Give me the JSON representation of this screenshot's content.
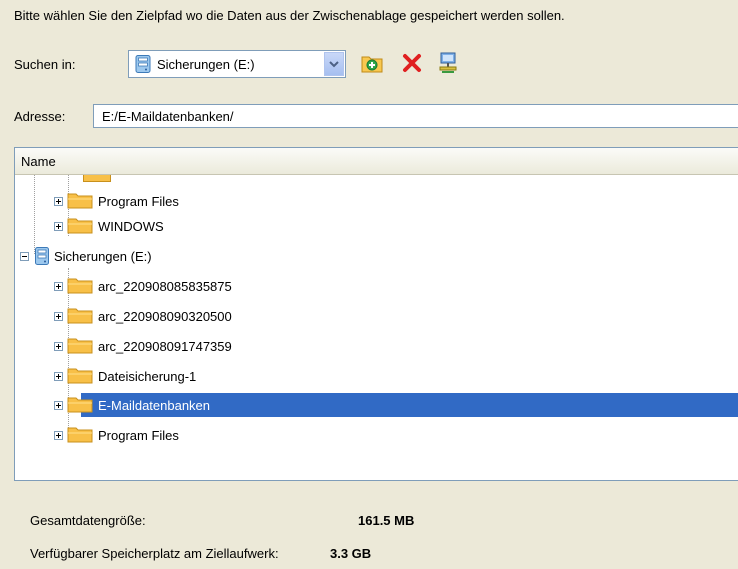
{
  "instruction": "Bitte wählen Sie den Zielpfad wo die Daten aus der Zwischenablage gespeichert werden sollen.",
  "search": {
    "label": "Suchen in:",
    "drive_value": "Sicherungen (E:)"
  },
  "toolbar": {
    "icons": [
      "new-folder-icon",
      "delete-icon",
      "network-icon"
    ]
  },
  "address": {
    "label": "Adresse:",
    "value": "E:/E-Maildatenbanken/"
  },
  "tree": {
    "header": "Name",
    "items": [
      {
        "label": "Program Files",
        "level": 1,
        "expander": "plus",
        "icon": "folder-icon"
      },
      {
        "label": "WINDOWS",
        "level": 1,
        "expander": "plus",
        "icon": "folder-icon"
      },
      {
        "label": "Sicherungen (E:)",
        "level": 0,
        "expander": "minus",
        "icon": "drive-icon"
      },
      {
        "label": "arc_220908085835875",
        "level": 1,
        "expander": "plus",
        "icon": "folder-icon"
      },
      {
        "label": "arc_220908090320500",
        "level": 1,
        "expander": "plus",
        "icon": "folder-icon"
      },
      {
        "label": "arc_220908091747359",
        "level": 1,
        "expander": "plus",
        "icon": "folder-icon"
      },
      {
        "label": "Dateisicherung-1",
        "level": 1,
        "expander": "plus",
        "icon": "folder-icon"
      },
      {
        "label": "E-Maildatenbanken",
        "level": 1,
        "expander": "plus",
        "icon": "folder-icon",
        "selected": true
      },
      {
        "label": "Program Files",
        "level": 1,
        "expander": "plus",
        "icon": "folder-icon"
      }
    ]
  },
  "summary": {
    "total_label": "Gesamtdatengröße:",
    "total_value": "161.5 MB",
    "free_label": "Verfügbarer Speicherplatz am Ziellaufwerk:",
    "free_value": "3.3 GB"
  },
  "colors": {
    "selection": "#316ac5",
    "folder": "#f8b840",
    "window_bg": "#ece9d8"
  }
}
